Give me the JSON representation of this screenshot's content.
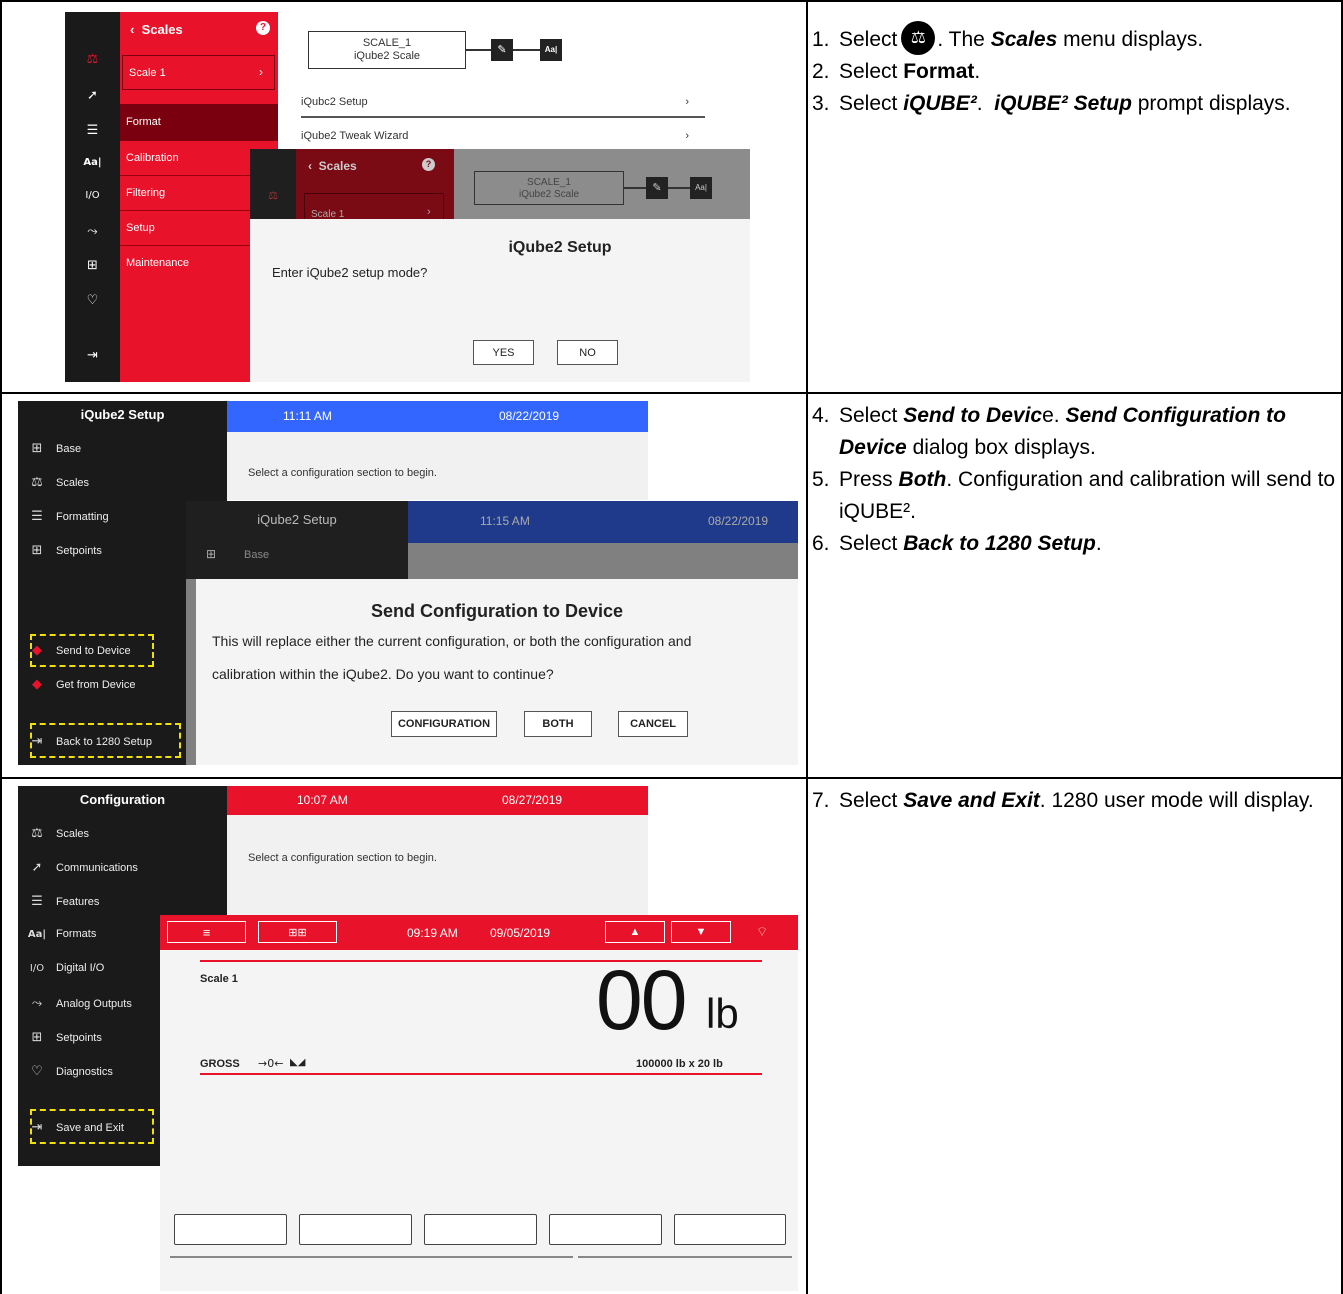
{
  "steps": {
    "s1": {
      "num": "1.",
      "a": "Select",
      "icon": "scale-icon",
      "b": ". The",
      "c": "Scales",
      "d": "menu displays."
    },
    "s2": {
      "num": "2.",
      "a": "Select",
      "b": "Format",
      "c": "."
    },
    "s3": {
      "num": "3.",
      "a": "Select",
      "b": "iQUBE²",
      "c": ".",
      "d": "iQUBE² Setup",
      "e": "prompt displays."
    },
    "s4": {
      "num": "4.",
      "a": "Select",
      "b": "Send to Devic",
      "c": "e.",
      "d": "Send Configuration to Device",
      "e": "dialog box displays."
    },
    "s5": {
      "num": "5.",
      "a": "Press",
      "b": "Both",
      "c": ". Configuration and calibration will send to iQUBE²."
    },
    "s6": {
      "num": "6.",
      "a": "Select",
      "b": "Back to 1280 Setup",
      "c": "."
    },
    "s7": {
      "num": "7.",
      "a": "Select",
      "b": "Save and Exit",
      "c": ". 1280 user mode will display."
    }
  },
  "shot1": {
    "menu_header": "Scales",
    "scale_item": "Scale 1",
    "menu": [
      "Format",
      "Calibration",
      "Filtering",
      "Setup",
      "Maintenance"
    ],
    "scale_box_line1": "SCALE_1",
    "scale_box_line2": "iQube2 Scale",
    "list": [
      "iQubc2 Setup",
      "iQube2 Tweak Wizard"
    ],
    "overlay_header": "Scales",
    "overlay_scale_item": "Scale 1",
    "overlay_box_line1": "SCALE_1",
    "overlay_box_line2": "iQube2 Scale",
    "dialog_title": "iQube2 Setup",
    "dialog_text": "Enter iQube2 setup mode?",
    "yes": "YES",
    "no": "NO",
    "font_icon_label": "Aa|"
  },
  "shot2": {
    "sidebar_title": "iQube2 Setup",
    "time": "11:11 AM",
    "date": "08/22/2019",
    "sidebar": [
      "Base",
      "Scales",
      "Formatting",
      "Setpoints"
    ],
    "send": "Send to Device",
    "get": "Get from Device",
    "back": "Back to 1280 Setup",
    "prompt": "Select a configuration section to begin.",
    "overlay_title": "iQube2 Setup",
    "overlay_time": "11:15 AM",
    "overlay_date": "08/22/2019",
    "overlay_base": "Base",
    "dialog_title": "Send Configuration to Device",
    "dialog_line1": "This will replace either the current configuration, or both the configuration and",
    "dialog_line2": "calibration within the iQube2. Do you want to continue?",
    "btn_config": "CONFIGURATION",
    "btn_both": "BOTH",
    "btn_cancel": "CANCEL"
  },
  "shot3": {
    "sidebar_title": "Configuration",
    "time": "10:07 AM",
    "date": "08/27/2019",
    "sidebar": [
      "Scales",
      "Communications",
      "Features",
      "Formats",
      "Digital I/O",
      "Analog Outputs",
      "Setpoints",
      "Diagnostics"
    ],
    "save": "Save and Exit",
    "prompt": "Select a configuration section to begin.",
    "user_time": "09:19 AM",
    "user_date": "09/05/2019",
    "scale": "Scale 1",
    "weight": "00",
    "unit": "lb",
    "gross": "GROSS",
    "zero": "→0←",
    "capacity": "100000 lb x 20 lb"
  },
  "colors": {
    "accent_red": "#e8132a",
    "blue": "#3366ff",
    "dark": "#1a1a1a",
    "highlight": "#f2e100"
  }
}
